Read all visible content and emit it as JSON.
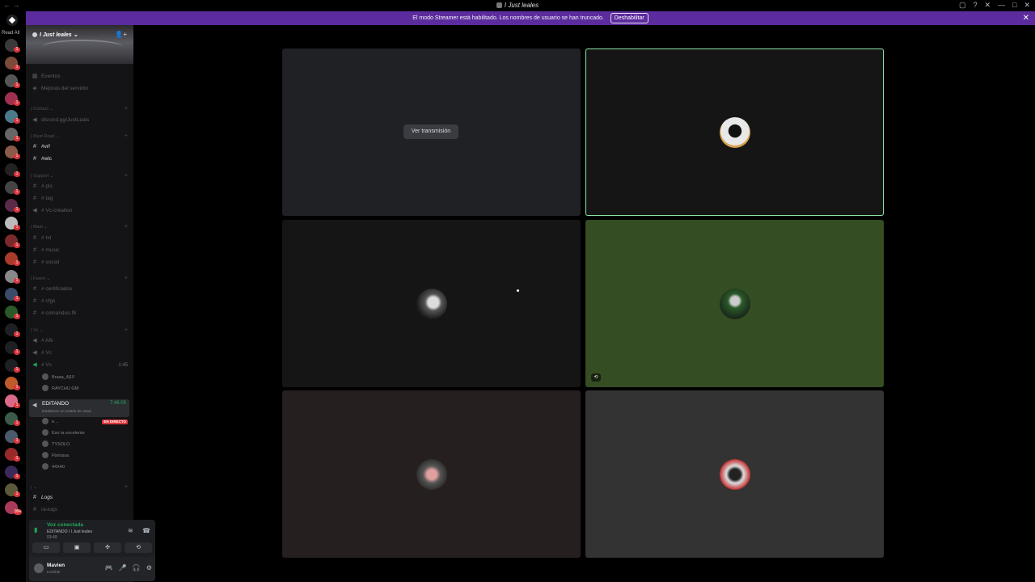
{
  "window": {
    "title": "I Just leales",
    "nav": "← →",
    "controls": [
      "▢",
      "?",
      "✕",
      "—",
      "□",
      "✕"
    ]
  },
  "banner": {
    "text": "El modo Streamer está habilitado. Los nombres de usuario se han truncado.",
    "button": "Deshabilitar",
    "close": "✕"
  },
  "rail": {
    "read_all": "Read All",
    "badges": [
      "1",
      "1",
      "1",
      "1",
      "1",
      "1",
      "1",
      "1",
      "1",
      "1",
      "1",
      "1",
      "1",
      "1",
      "1",
      "1",
      "1",
      "1",
      "1",
      "1",
      "1",
      "1",
      "1",
      "1",
      "1",
      "1",
      "1",
      "1",
      "1",
      "1",
      "1",
      "1",
      "99+"
    ]
  },
  "guild": {
    "name": "I Just leales",
    "chevron": "⌄",
    "invite_icon": "👤+"
  },
  "channels": {
    "events": "Eventos",
    "boosts": "Mejoras del servidor",
    "categories": {
      "contact": "| Contact ⌄",
      "must_read": "| Must Read ⌄",
      "support": "| Support ⌄",
      "main": "| Main ⌄",
      "fivem": "| Fivem ⌄",
      "vc": "| Vc ⌄",
      "misc": "| ⌄"
    },
    "items": {
      "invite_link": "discord.gg/JustLeals",
      "vrf": "#vrf",
      "wlc": "#wlc",
      "pls": "# pls",
      "tag": "# tag",
      "vc_creation": "# Vc-creation",
      "txt": "# txt",
      "music": "# music",
      "social": "# social",
      "certificados": "# certificados",
      "cfgs": "# cfgs",
      "comandos_f8": "# comandos-f8",
      "afk": "# Afk",
      "vc1": "# Vc",
      "vc2": "# Vc",
      "vc2_time": "1:45",
      "logs": "Logs",
      "ra_logs": "ra-logs"
    },
    "vc2_users": [
      "Braaa_4j10",
      "RAYCHU GM"
    ],
    "active_vc": {
      "name": "EDITANDO",
      "subtitle": "Establecer un estado de canal",
      "time": "7:46:05"
    },
    "editando_users": [
      "e...",
      "Eso ta excelente",
      "TYSOLO",
      "Fbriossa",
      "44X40"
    ],
    "live_label": "EN DIRECTO"
  },
  "voice_panel": {
    "status": "Voz conectada",
    "location": "EDITANDO / I Just leales",
    "time": "03:49",
    "buttons": [
      "▭",
      "▣",
      "✣",
      "⟲"
    ],
    "user": {
      "name": "Mavien",
      "sub": "Invisible"
    },
    "user_icons": [
      "🎮",
      "🎤",
      "🎧",
      "⚙"
    ]
  },
  "grid": {
    "watch_label": "Ver transmisión",
    "tile_tag": "⟲",
    "colors": {
      "stream": "#1f2125",
      "dark": "#151515",
      "green": "#344d22",
      "brown": "#261f1f",
      "grey": "#333333",
      "speaking": "#8ee6a8"
    }
  }
}
